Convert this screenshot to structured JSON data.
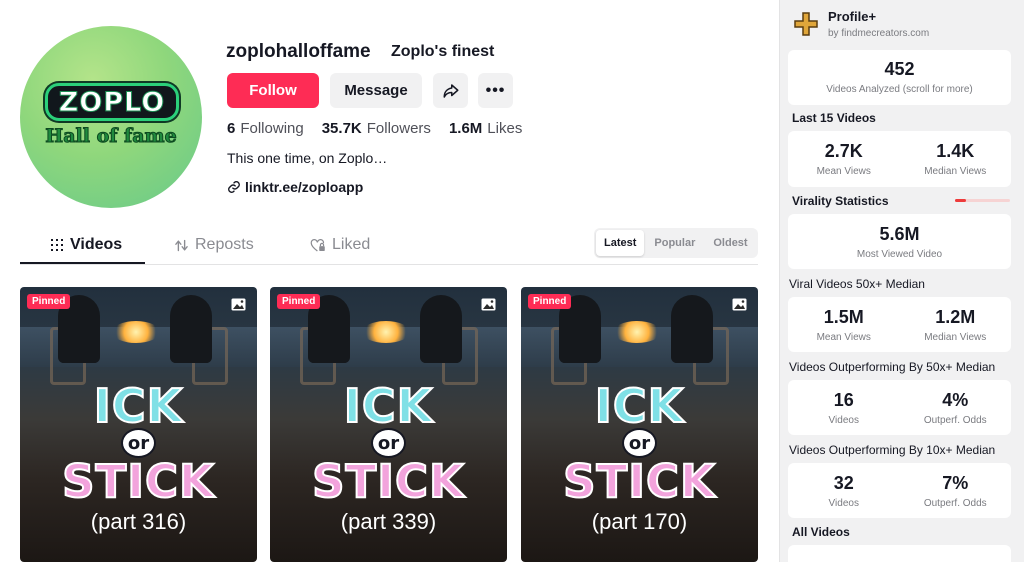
{
  "profile": {
    "avatar_logo_text": "ZOPLO",
    "avatar_logo_subtext": "Hall of fame",
    "username": "zoplohalloffame",
    "nickname": "Zoplo's finest",
    "follow_label": "Follow",
    "message_label": "Message",
    "share_icon": "share-icon",
    "more_icon": "more-icon",
    "more_glyph": "•••",
    "stats": [
      {
        "value": "6",
        "label": "Following"
      },
      {
        "value": "35.7K",
        "label": "Followers"
      },
      {
        "value": "1.6M",
        "label": "Likes"
      }
    ],
    "bio": "This one time, on Zoplo…",
    "link": "linktr.ee/zoploapp"
  },
  "tabs": [
    {
      "label": "Videos",
      "icon": "grid-icon",
      "active": true
    },
    {
      "label": "Reposts",
      "icon": "repost-icon",
      "active": false
    },
    {
      "label": "Liked",
      "icon": "heart-lock-icon",
      "active": false
    }
  ],
  "sort_options": [
    {
      "label": "Latest",
      "active": true
    },
    {
      "label": "Popular",
      "active": false
    },
    {
      "label": "Oldest",
      "active": false
    }
  ],
  "videos": [
    {
      "badge": "Pinned",
      "title_top": "ICK",
      "title_mid": "or",
      "title_bottom": "STICK",
      "part": "(part 316)",
      "icon": "photo-icon"
    },
    {
      "badge": "Pinned",
      "title_top": "ICK",
      "title_mid": "or",
      "title_bottom": "STICK",
      "part": "(part 339)",
      "icon": "photo-icon"
    },
    {
      "badge": "Pinned",
      "title_top": "ICK",
      "title_mid": "or",
      "title_bottom": "STICK",
      "part": "(part 170)",
      "icon": "photo-icon"
    }
  ],
  "panel": {
    "title": "Profile+",
    "subtitle": "by findmecreators.com",
    "icon": "plus-logo-icon",
    "videos_analyzed": {
      "value": "452",
      "label": "Videos Analyzed (scroll for more)"
    },
    "last15": {
      "heading": "Last 15 Videos",
      "left": {
        "value": "2.7K",
        "label": "Mean Views"
      },
      "right": {
        "value": "1.4K",
        "label": "Median Views"
      }
    },
    "virality": {
      "heading": "Virality Statistics",
      "level": 0.2,
      "most_viewed": {
        "value": "5.6M",
        "label": "Most Viewed Video"
      }
    },
    "viral50": {
      "heading": "Viral Videos 50x+ Median",
      "left": {
        "value": "1.5M",
        "label": "Mean Views"
      },
      "right": {
        "value": "1.2M",
        "label": "Median Views"
      }
    },
    "outperf50": {
      "heading": "Videos Outperforming By 50x+ Median",
      "left": {
        "value": "16",
        "label": "Videos"
      },
      "right": {
        "value": "4%",
        "label": "Outperf. Odds"
      }
    },
    "outperf10": {
      "heading": "Videos Outperforming By 10x+ Median",
      "left": {
        "value": "32",
        "label": "Videos"
      },
      "right": {
        "value": "7%",
        "label": "Outperf. Odds"
      }
    },
    "all_videos": {
      "heading": "All Videos"
    }
  },
  "colors": {
    "accent": "#fe2c55",
    "virality_bar": "#ee3b3b",
    "panel_bg": "#f1f1f2"
  }
}
